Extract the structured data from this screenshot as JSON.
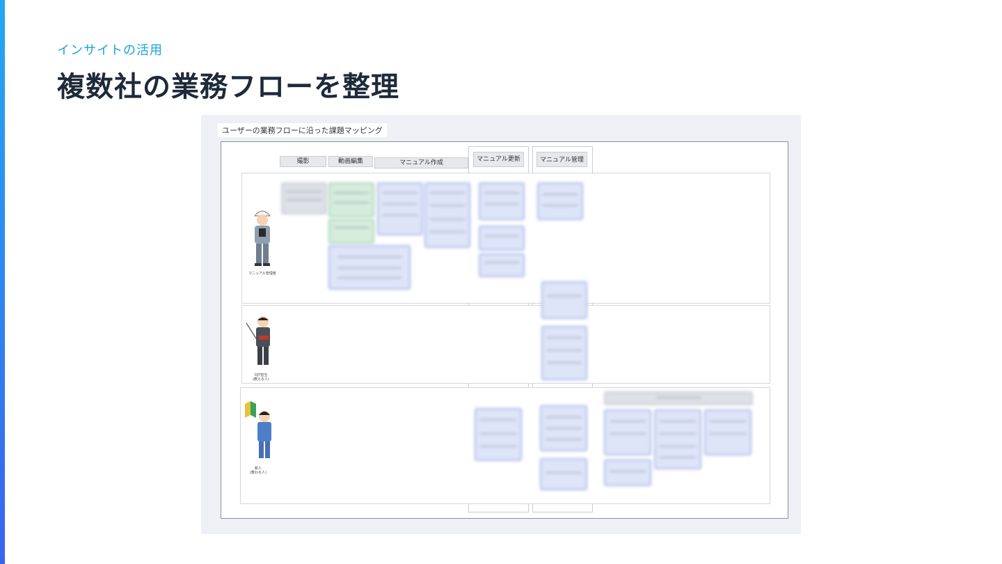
{
  "header": {
    "eyebrow": "インサイトの活用",
    "title": "複数社の業務フローを整理"
  },
  "figure": {
    "caption": "ユーザーの業務フローに沿った課題マッピング",
    "phases": [
      "撮影",
      "動画編集",
      "マニュアル作成",
      "マニュアル更新",
      "マニュアル管理"
    ],
    "lanes": [
      {
        "label": "マニュアル管理者",
        "icon": "worker-helmet-icon"
      },
      {
        "label": "OJT担当\n(教える人)",
        "icon": "teacher-pointer-icon"
      },
      {
        "label": "新人\n(教わる人)",
        "icon": "beginner-mark-icon"
      }
    ]
  },
  "colors": {
    "accent_top": "#23a8f2",
    "accent_bottom": "#3a64f0",
    "eyebrow": "#1aa3e0",
    "title": "#1e2a3a",
    "card_green": "#d6ecdc",
    "card_blue": "#dfe5f8",
    "card_gray": "#dde0e6"
  }
}
